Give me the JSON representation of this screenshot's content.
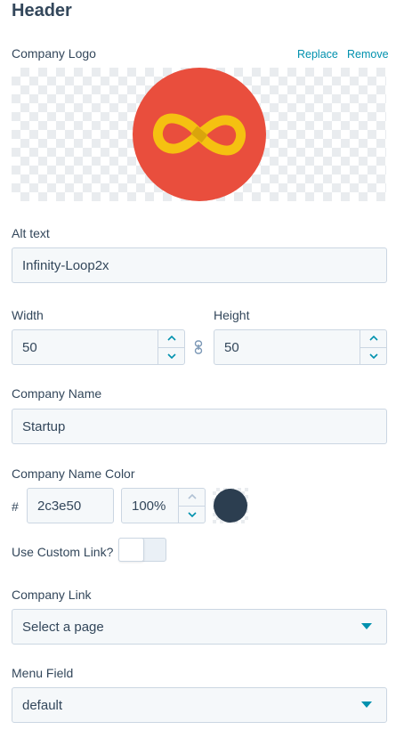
{
  "header": {
    "title": "Header"
  },
  "logo": {
    "label": "Company Logo",
    "replace_label": "Replace",
    "remove_label": "Remove",
    "colors": {
      "circle": "#e94e3d",
      "loop": "#f5c111"
    }
  },
  "alt_text": {
    "label": "Alt text",
    "value": "Infinity-Loop2x"
  },
  "width": {
    "label": "Width",
    "value": "50"
  },
  "height": {
    "label": "Height",
    "value": "50"
  },
  "link_icon": "link-icon",
  "company_name": {
    "label": "Company Name",
    "value": "Startup"
  },
  "company_name_color": {
    "label": "Company Name Color",
    "hash": "#",
    "hex_value": "2c3e50",
    "opacity_value": "100%",
    "swatch_color": "#2c3e50"
  },
  "custom_link": {
    "label": "Use Custom Link?",
    "enabled": false
  },
  "company_link": {
    "label": "Company Link",
    "selected": "Select a page"
  },
  "menu_field": {
    "label": "Menu Field",
    "selected": "default"
  },
  "colors": {
    "text": "#33475b",
    "link": "#0091ae",
    "field_bg": "#f5f8fa",
    "field_border": "#cbd6e2",
    "accent": "#0091ae"
  }
}
